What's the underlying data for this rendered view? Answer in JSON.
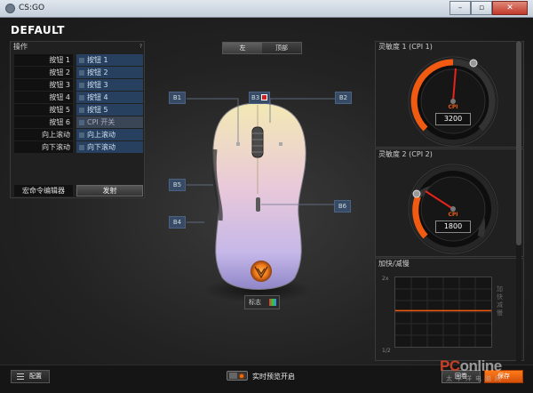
{
  "window": {
    "title": "CS:GO",
    "controls": [
      "–",
      "▫",
      "✕"
    ]
  },
  "profile": {
    "name": "DEFAULT"
  },
  "actions": {
    "title": "操作",
    "rows": [
      {
        "key": "按钮 1",
        "value": "按钮 1"
      },
      {
        "key": "按钮 2",
        "value": "按钮 2"
      },
      {
        "key": "按钮 3",
        "value": "按钮 3"
      },
      {
        "key": "按钮 4",
        "value": "按钮 4"
      },
      {
        "key": "按钮 5",
        "value": "按钮 5"
      },
      {
        "key": "按钮 6",
        "value": "CPI 开关"
      },
      {
        "key": "向上滚动",
        "value": "向上滚动"
      },
      {
        "key": "向下滚动",
        "value": "向下滚动"
      }
    ],
    "macro_label": "宏命令编辑器",
    "fire_label": "发射"
  },
  "view_tabs": [
    "左",
    "顶部"
  ],
  "mouse_buttons": [
    "B1",
    "B2",
    "B3",
    "B4",
    "B5",
    "B6"
  ],
  "logo_label": "标志",
  "sensitivity": [
    {
      "title": "灵敏度 1 (CPI 1)",
      "unit": "CPI",
      "value": "3200"
    },
    {
      "title": "灵敏度 2 (CPI 2)",
      "unit": "CPI",
      "value": "1800"
    }
  ],
  "accel": {
    "title": "加快/减慢",
    "top_label": "2x",
    "bottom_label": "1/2",
    "side_label": "加快减慢",
    "level": 0.52
  },
  "bottom": {
    "config_label": "配置",
    "preview_label": "实时预览开启",
    "revert_label": "回卷",
    "save_label": "保存"
  },
  "watermark": {
    "main_a": "PC",
    "main_b": "online",
    "sub": "太平洋电脑网"
  },
  "colors": {
    "accent": "#f25a12",
    "button_blue": "#27405f"
  }
}
